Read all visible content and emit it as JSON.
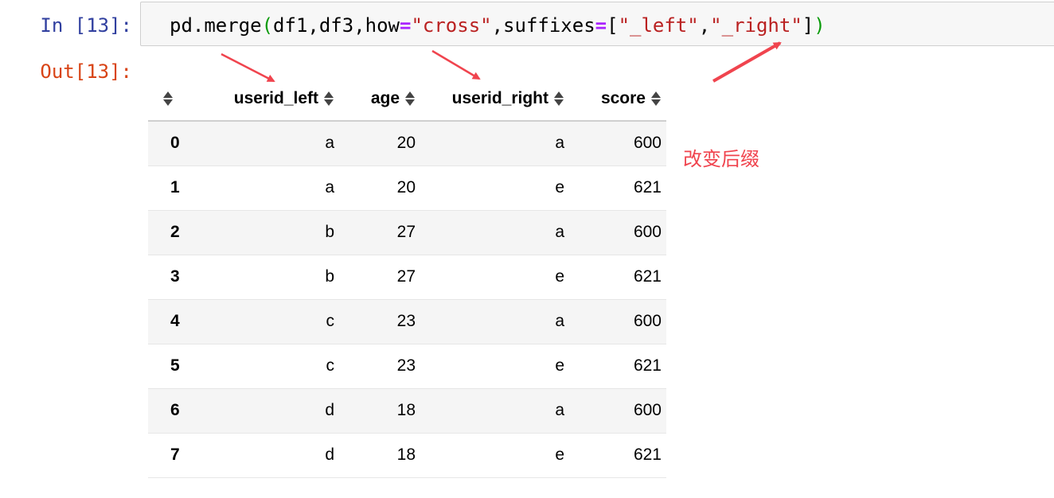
{
  "cell": {
    "in_prompt": "In [13]:",
    "out_prompt": "Out[13]:",
    "code": {
      "prefix": "pd.merge",
      "open_paren": "(",
      "args1": "df1,df3,how",
      "eq1": "=",
      "str1": "\"cross\"",
      "comma1": ",suffixes",
      "eq2": "=",
      "bracket_open": "[",
      "str2": "\"_left\"",
      "comma2": ",",
      "str3": "\"_right\"",
      "bracket_close": "]",
      "close_paren": ")"
    }
  },
  "table": {
    "columns": [
      "userid_left",
      "age",
      "userid_right",
      "score"
    ],
    "rows": [
      {
        "index": "0",
        "userid_left": "a",
        "age": "20",
        "userid_right": "a",
        "score": "600"
      },
      {
        "index": "1",
        "userid_left": "a",
        "age": "20",
        "userid_right": "e",
        "score": "621"
      },
      {
        "index": "2",
        "userid_left": "b",
        "age": "27",
        "userid_right": "a",
        "score": "600"
      },
      {
        "index": "3",
        "userid_left": "b",
        "age": "27",
        "userid_right": "e",
        "score": "621"
      },
      {
        "index": "4",
        "userid_left": "c",
        "age": "23",
        "userid_right": "a",
        "score": "600"
      },
      {
        "index": "5",
        "userid_left": "c",
        "age": "23",
        "userid_right": "e",
        "score": "621"
      },
      {
        "index": "6",
        "userid_left": "d",
        "age": "18",
        "userid_right": "a",
        "score": "600"
      },
      {
        "index": "7",
        "userid_left": "d",
        "age": "18",
        "userid_right": "e",
        "score": "621"
      }
    ]
  },
  "annotation": {
    "text": "改变后缀",
    "color": "#f0444e"
  },
  "colors": {
    "in_prompt": "#303f9f",
    "out_prompt": "#d84315",
    "string": "#ba2121",
    "operator": "#aa22ff",
    "paren": "#0a9b0a",
    "arrow": "#f0444e"
  }
}
